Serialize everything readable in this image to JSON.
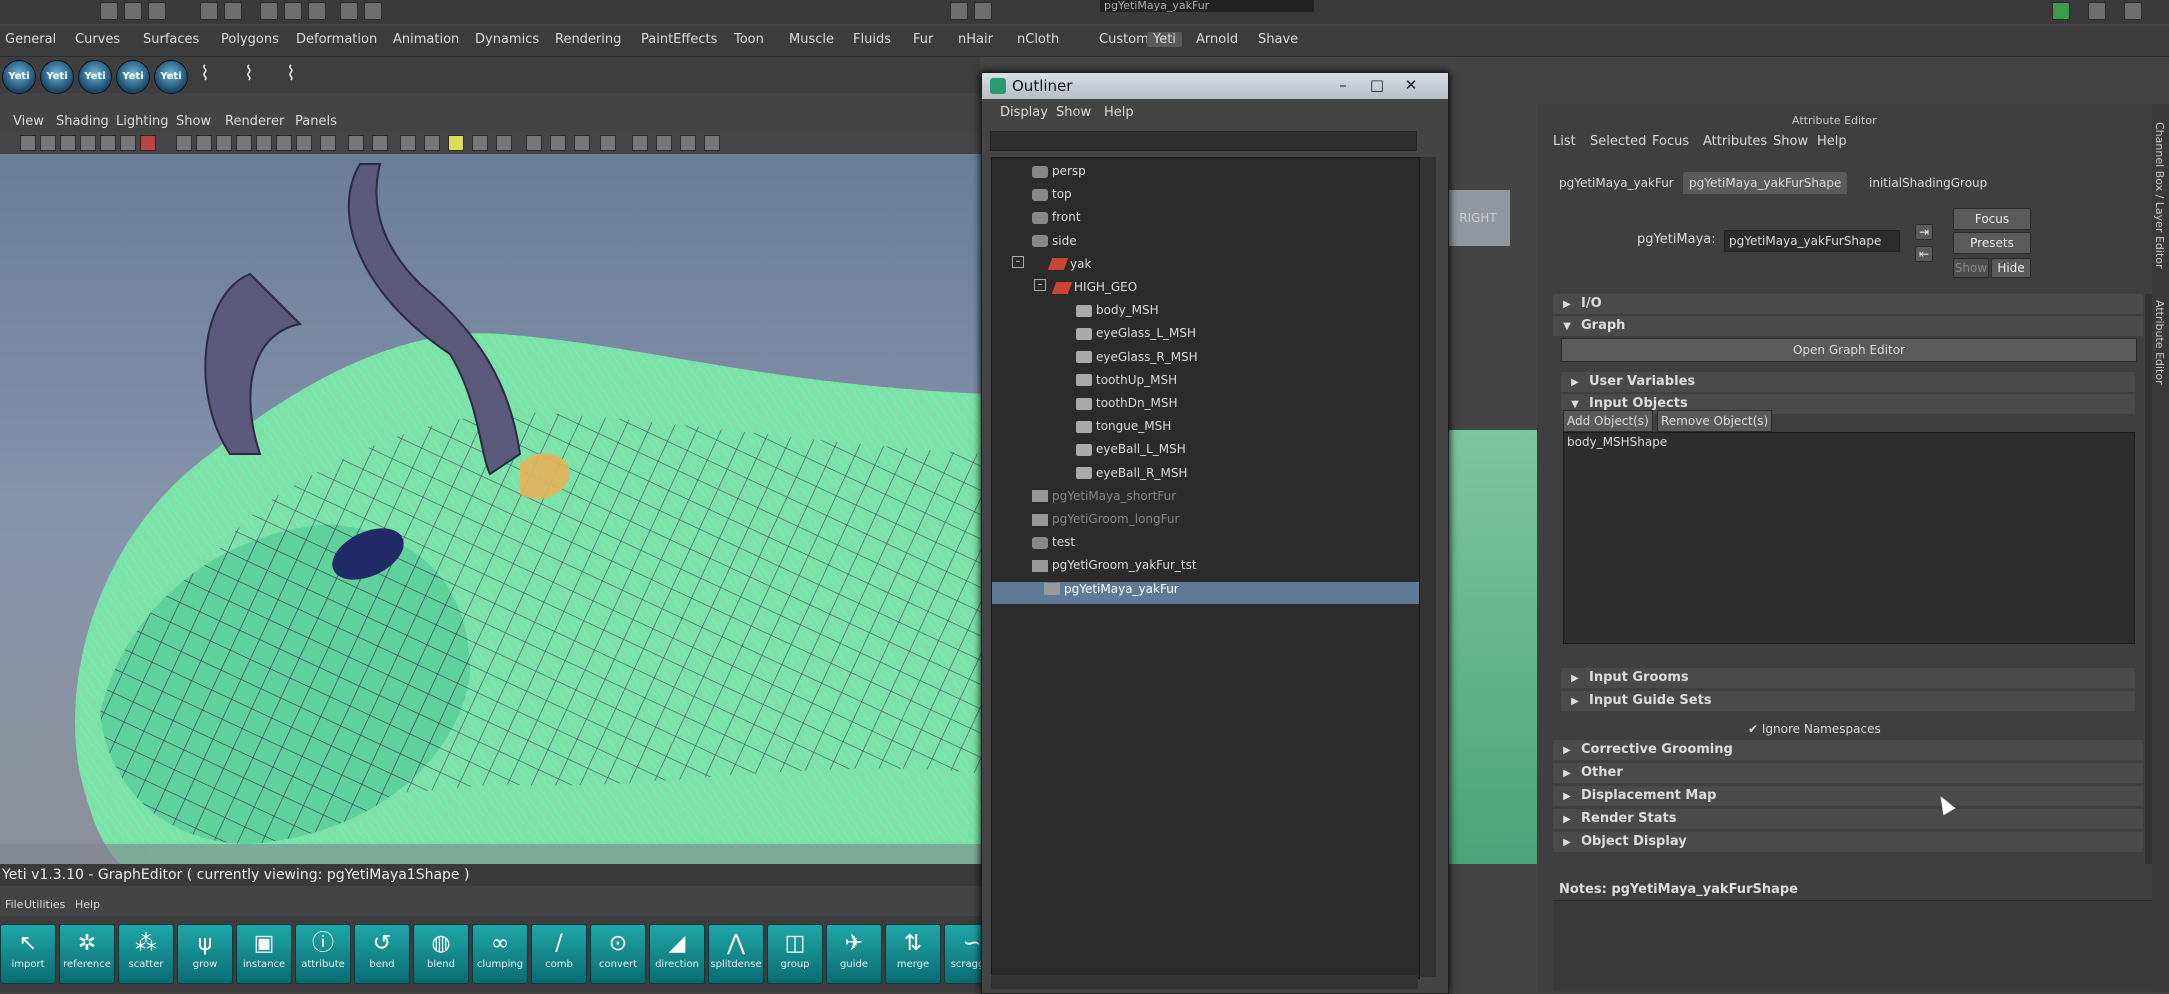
{
  "topbar": {
    "file_field": "pgYetiMaya_yakFur"
  },
  "shelf_tabs": [
    "General",
    "Curves",
    "Surfaces",
    "Polygons",
    "Deformation",
    "Animation",
    "Dynamics",
    "Rendering",
    "PaintEffects",
    "Toon",
    "Muscle",
    "Fluids",
    "Fur",
    "nHair",
    "nCloth",
    "Custom",
    "Yeti",
    "Arnold",
    "Shave"
  ],
  "shelf_active": "Yeti",
  "yeti_icons": [
    "Yeti",
    "Yeti",
    "Yeti",
    "Yeti",
    "Yeti"
  ],
  "viewport": {
    "menu": [
      "View",
      "Shading",
      "Lighting",
      "Show",
      "Renderer",
      "Panels"
    ],
    "viewcube_label": "RIGHT"
  },
  "graph_editor": {
    "title": "Yeti v1.3.10 - GraphEditor ( currently viewing: pgYetiMaya1Shape )",
    "menu": [
      "File",
      "Utilities",
      "Help"
    ],
    "tools": [
      {
        "label": "import",
        "glyph": "↖"
      },
      {
        "label": "reference",
        "glyph": "✲"
      },
      {
        "label": "scatter",
        "glyph": "⁂"
      },
      {
        "label": "grow",
        "glyph": "ψ"
      },
      {
        "label": "instance",
        "glyph": "▣"
      },
      {
        "label": "attribute",
        "glyph": "ⓘ"
      },
      {
        "label": "bend",
        "glyph": "↺"
      },
      {
        "label": "blend",
        "glyph": "◍"
      },
      {
        "label": "clumping",
        "glyph": "∞"
      },
      {
        "label": "comb",
        "glyph": "/"
      },
      {
        "label": "convert",
        "glyph": "⊙"
      },
      {
        "label": "direction",
        "glyph": "◢"
      },
      {
        "label": "splitdense",
        "glyph": "⋀"
      },
      {
        "label": "group",
        "glyph": "◫"
      },
      {
        "label": "guide",
        "glyph": "✈"
      },
      {
        "label": "merge",
        "glyph": "⇅"
      },
      {
        "label": "scraggle",
        "glyph": "∽"
      }
    ]
  },
  "outliner": {
    "title": "Outliner",
    "menu": [
      "Display",
      "Show",
      "Help"
    ],
    "items": [
      {
        "label": "persp",
        "type": "cam",
        "indent": 0,
        "dim": false,
        "sel": false
      },
      {
        "label": "top",
        "type": "cam",
        "indent": 0,
        "dim": false,
        "sel": false
      },
      {
        "label": "front",
        "type": "cam",
        "indent": 0,
        "dim": false,
        "sel": false
      },
      {
        "label": "side",
        "type": "cam",
        "indent": 0,
        "dim": false,
        "sel": false
      },
      {
        "label": "yak",
        "type": "xf",
        "indent": 0,
        "dim": false,
        "sel": false
      },
      {
        "label": "HIGH_GEO",
        "type": "xf",
        "indent": 1,
        "dim": false,
        "sel": false
      },
      {
        "label": "body_MSH",
        "type": "mesh",
        "indent": 2,
        "dim": false,
        "sel": false
      },
      {
        "label": "eyeGlass_L_MSH",
        "type": "mesh",
        "indent": 2,
        "dim": false,
        "sel": false
      },
      {
        "label": "eyeGlass_R_MSH",
        "type": "mesh",
        "indent": 2,
        "dim": false,
        "sel": false
      },
      {
        "label": "toothUp_MSH",
        "type": "mesh",
        "indent": 2,
        "dim": false,
        "sel": false
      },
      {
        "label": "toothDn_MSH",
        "type": "mesh",
        "indent": 2,
        "dim": false,
        "sel": false
      },
      {
        "label": "tongue_MSH",
        "type": "mesh",
        "indent": 2,
        "dim": false,
        "sel": false
      },
      {
        "label": "eyeBall_L_MSH",
        "type": "mesh",
        "indent": 2,
        "dim": false,
        "sel": false
      },
      {
        "label": "eyeBall_R_MSH",
        "type": "mesh",
        "indent": 2,
        "dim": false,
        "sel": false
      },
      {
        "label": "pgYetiMaya_shortFur",
        "type": "sh",
        "indent": 0,
        "dim": true,
        "sel": false
      },
      {
        "label": "pgYetiGroom_longFur",
        "type": "sh",
        "indent": 0,
        "dim": true,
        "sel": false
      },
      {
        "label": "test",
        "type": "cam",
        "indent": 0,
        "dim": false,
        "sel": false
      },
      {
        "label": "pgYetiGroom_yakFur_tst",
        "type": "sh",
        "indent": 0,
        "dim": false,
        "sel": false
      },
      {
        "label": "pgYetiMaya_yakFur",
        "type": "sh",
        "indent": 0,
        "dim": false,
        "sel": true
      }
    ]
  },
  "attribute_editor": {
    "header": "Attribute Editor",
    "menu": [
      "List",
      "Selected",
      "Focus",
      "Attributes",
      "Show",
      "Help"
    ],
    "tabs": [
      "pgYetiMaya_yakFur",
      "pgYetiMaya_yakFurShape",
      "initialShadingGroup"
    ],
    "active_tab": 1,
    "node_label": "pgYetiMaya:",
    "node_value": "pgYetiMaya_yakFurShape",
    "focus_btn": "Focus",
    "presets_btn": "Presets",
    "show_btn": "Show",
    "hide_btn": "Hide",
    "sections_top": [
      {
        "label": "I/O",
        "open": false
      },
      {
        "label": "Graph",
        "open": true
      }
    ],
    "open_graph_editor": "Open Graph Editor",
    "user_variables": "User Variables",
    "input_objects": "Input Objects",
    "add_objects": "Add Object(s)",
    "remove_objects": "Remove Object(s)",
    "input_list": [
      "body_MSHShape"
    ],
    "input_grooms": "Input Grooms",
    "input_guide_sets": "Input Guide Sets",
    "ignore_namespaces": "Ignore Namespaces",
    "sections_bottom": [
      "Corrective Grooming",
      "Other",
      "Displacement Map",
      "Render Stats",
      "Object Display"
    ],
    "notes_label": "Notes:",
    "notes_value": "pgYetiMaya_yakFurShape"
  },
  "right_strip": [
    "Channel Box / Layer Editor",
    "Attribute Editor"
  ]
}
